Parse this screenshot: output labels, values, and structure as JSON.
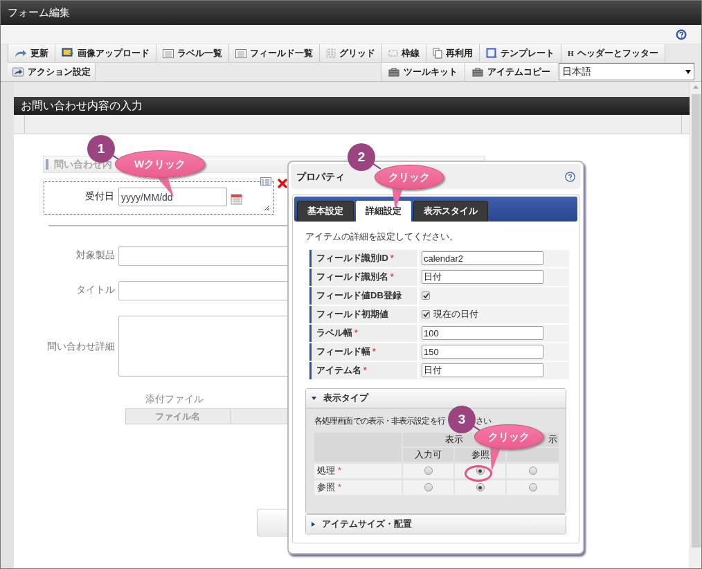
{
  "window": {
    "title": "フォーム編集"
  },
  "toolbar": {
    "row1": [
      {
        "label": "更新"
      },
      {
        "label": "画像アップロード"
      },
      {
        "label": "ラベル一覧"
      },
      {
        "label": "フィールド一覧"
      },
      {
        "label": "グリッド"
      },
      {
        "label": "枠線"
      },
      {
        "label": "再利用"
      },
      {
        "label": "テンプレート"
      },
      {
        "label": "ヘッダーとフッター",
        "glyph": "H"
      }
    ],
    "row2_left": [
      {
        "label": "アクション設定"
      }
    ],
    "row2_right": [
      {
        "label": "ツールキット"
      },
      {
        "label": "アイテムコピー"
      }
    ],
    "language": "日本語"
  },
  "form": {
    "title": "お問い合わせ内容の入力",
    "section_heading": "問い合わせ内",
    "selected_field": {
      "label": "受付日",
      "placeholder": "yyyy/MM/dd"
    },
    "fields": [
      {
        "label": "対象製品",
        "kind": "text"
      },
      {
        "label": "タイトル",
        "kind": "text"
      },
      {
        "label": "問い合わせ詳細",
        "kind": "textarea"
      }
    ],
    "attachment": {
      "label": "添付ファイル",
      "columns": [
        "ファイル名"
      ]
    }
  },
  "dialog": {
    "title": "プロパティ",
    "tabs": [
      {
        "label": "基本設定",
        "selected": false
      },
      {
        "label": "詳細設定",
        "selected": true
      },
      {
        "label": "表示スタイル",
        "selected": false
      }
    ],
    "intro": "アイテムの詳細を設定してください。",
    "properties": [
      {
        "label": "フィールド識別ID",
        "mark": "*",
        "kind": "input",
        "value": "calendar2"
      },
      {
        "label": "フィールド識別名",
        "mark": "*",
        "kind": "input",
        "value": "日付"
      },
      {
        "label": "フィールド値DB登録",
        "kind": "checkbox",
        "checked": true
      },
      {
        "label": "フィールド初期値",
        "kind": "checkbox",
        "checked": true,
        "text": "現在の日付"
      },
      {
        "label": "ラベル幅",
        "mark": "*",
        "kind": "input",
        "value": "100"
      },
      {
        "label": "フィールド幅",
        "mark": "*",
        "kind": "input",
        "value": "150"
      },
      {
        "label": "アイテム名",
        "mark": "*",
        "kind": "input",
        "value": "日付"
      }
    ],
    "sections": [
      {
        "title": "表示タイプ",
        "expanded": true,
        "note_start": "各処理画面での表示・非表示設定を行",
        "note_end": "さい",
        "group_header": "表示",
        "group_header_2": "示",
        "columns": [
          "入力可",
          "参照"
        ],
        "rows": [
          {
            "label": "処理",
            "mark": "*",
            "choices": [
              {
                "selected": false
              },
              {
                "selected": true
              },
              {
                "selected": false
              }
            ]
          },
          {
            "label": "参照",
            "mark": "*",
            "choices": [
              {
                "selected": false
              },
              {
                "selected": true
              },
              {
                "selected": false
              }
            ]
          }
        ]
      },
      {
        "title": "アイテムサイズ・配置",
        "expanded": false
      }
    ]
  },
  "callouts": [
    {
      "number": "1",
      "text": "Wクリック"
    },
    {
      "number": "2",
      "text": "クリック"
    },
    {
      "number": "3",
      "text": "クリック"
    }
  ]
}
